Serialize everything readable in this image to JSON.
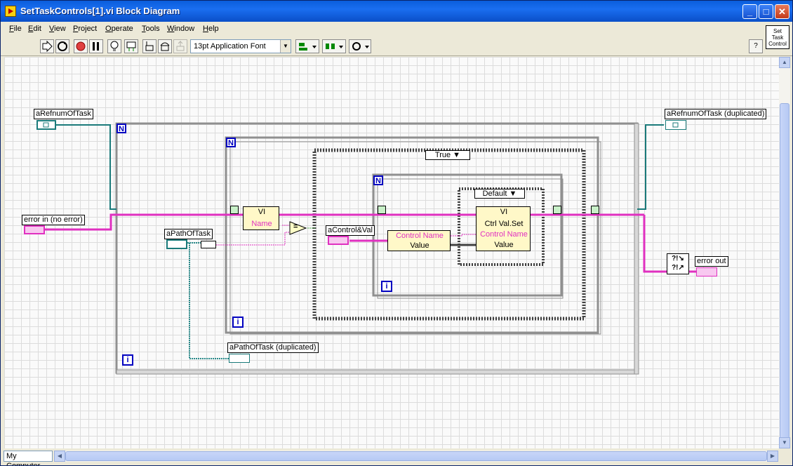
{
  "window": {
    "title": "SetTaskControls[1].vi Block Diagram",
    "min_glyph": "_",
    "max_glyph": "□",
    "close_glyph": "✕"
  },
  "menu": {
    "items": [
      "File",
      "Edit",
      "View",
      "Project",
      "Operate",
      "Tools",
      "Window",
      "Help"
    ]
  },
  "toolbar": {
    "font_select": "13pt Application Font",
    "help_glyph": "?"
  },
  "vi_icon": {
    "text_lines": [
      "Set",
      "Task",
      "Control"
    ]
  },
  "diagram": {
    "terminals": {
      "refnum_in": "aRefnumOfTask",
      "refnum_out": "aRefnumOfTask (duplicated)",
      "error_in": "error in (no error)",
      "error_out": "error out",
      "path_in": "aPathOfTask",
      "path_out": "aPathOfTask (duplicated)",
      "control_val": "aControl&Val"
    },
    "loop_labels": {
      "count": "N",
      "iteration": "i"
    },
    "case_structure_outer": "True",
    "case_structure_inner": "Default",
    "nodes": {
      "open_ref": "VI",
      "open_ref_prop": "Name",
      "invoke": "VI",
      "invoke_method": "Ctrl Val.Set",
      "invoke_param1": "Control Name",
      "invoke_param2": "Value",
      "unbundle_field1": "Control Name",
      "unbundle_field2": "Value",
      "equal": "="
    }
  },
  "status": {
    "context": "My Computer"
  },
  "colors": {
    "error_wire": "#e030c0",
    "refnum_wire": "#1a7a7a",
    "path_wire": "#2a8a8a",
    "loop_border": "#a0a0a0",
    "case_border": "#404040",
    "loop_label_color": "#0000c0",
    "cluster_fill": "#fff8c8"
  }
}
